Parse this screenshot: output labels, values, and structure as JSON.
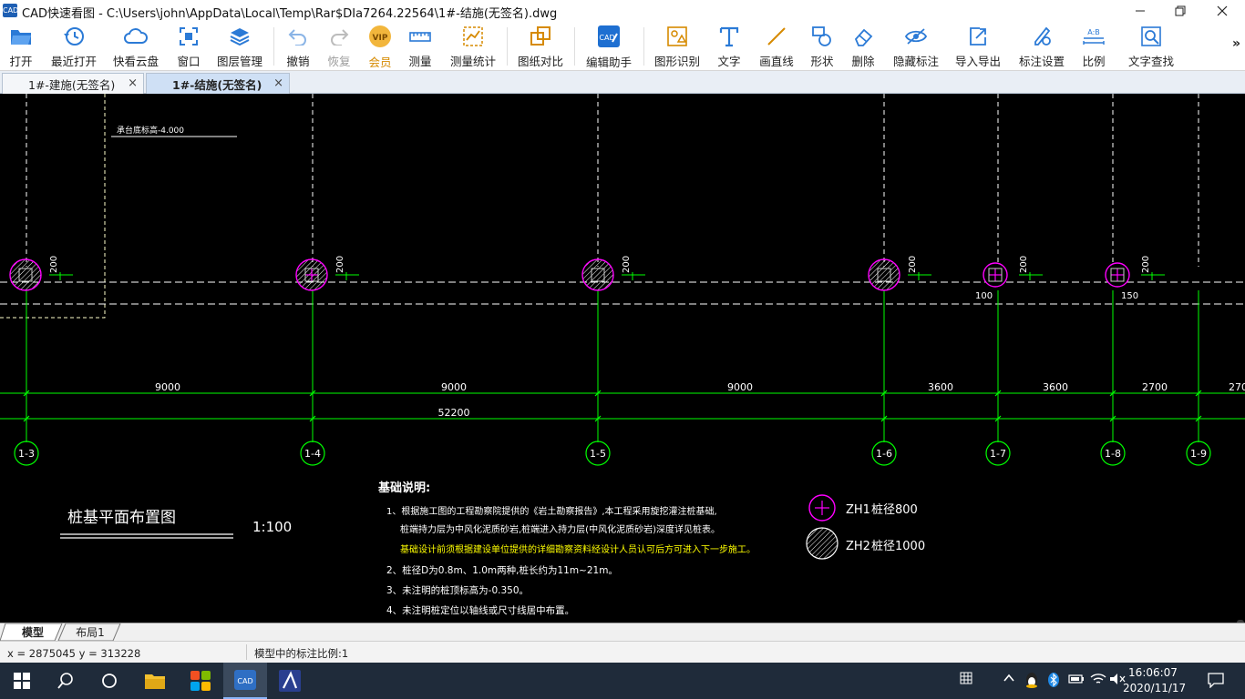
{
  "window": {
    "app_icon": "CAD",
    "title": "CAD快速看图 - C:\\Users\\john\\AppData\\Local\\Temp\\Rar$DIa7264.22564\\1#-结施(无签名).dwg"
  },
  "toolbar": {
    "open": "打开",
    "recent": "最近打开",
    "cloud": "快看云盘",
    "window": "窗口",
    "layers": "图层管理",
    "undo": "撤销",
    "redo": "恢复",
    "vip": "会员",
    "measure": "测量",
    "measure_stats": "测量统计",
    "compare": "图纸对比",
    "edit_assist": "编辑助手",
    "shape_recog": "图形识别",
    "text": "文字",
    "line": "画直线",
    "shape": "形状",
    "delete": "删除",
    "hide_dims": "隐藏标注",
    "import_export": "导入导出",
    "dim_settings": "标注设置",
    "ratio": "比例",
    "text_search": "文字查找",
    "more": "»"
  },
  "tabs": [
    {
      "label": "1#-建施(无签名)",
      "close": "×"
    },
    {
      "label": "1#-结施(无签名)",
      "close": "×"
    }
  ],
  "drawing": {
    "top_note": "承台底标高-4.000",
    "axes": [
      "1-3",
      "1-4",
      "1-5",
      "1-6",
      "1-7",
      "1-8",
      "1-9"
    ],
    "pile_dims": [
      "200",
      "200",
      "200",
      "200",
      "200",
      "200"
    ],
    "offset_labels": [
      "100",
      "150"
    ],
    "spans": [
      "9000",
      "9000",
      "9000",
      "3600",
      "3600",
      "2700",
      "270"
    ],
    "total_span": "52200",
    "plan_title": "桩基平面布置图",
    "plan_scale": "1:100",
    "notes_title": "基础说明:",
    "notes": [
      "1、根据施工图的工程勘察院提供的《岩土勘察报告》,本工程采用旋挖灌注桩基础,",
      "桩端持力层为中风化泥质砂岩,桩端进入持力层(中风化泥质砂岩)深度详见桩表。",
      "基础设计前须根据建设单位提供的详细勘察资料经设计人员认可后方可进入下一步施工。",
      "2、桩径D为0.8m、1.0m两种,桩长约为11m~21m。",
      "3、未注明的桩顶标高为-0.350。",
      "4、未注明桩定位以轴线或尺寸线居中布置。"
    ],
    "legend": [
      {
        "code": "ZH1",
        "desc": "桩径800"
      },
      {
        "code": "ZH2",
        "desc": "桩径1000"
      }
    ],
    "colors": {
      "axis": "#00ff00",
      "grid": "#ffffff",
      "pile": "#ff00ff",
      "note_highlight": "#ffff00"
    }
  },
  "layout_tabs": [
    "模型",
    "布局1"
  ],
  "status": {
    "coords": "x = 2875045  y = 313228",
    "scale": "模型中的标注比例:1"
  },
  "taskbar": {
    "time": "16:06:07",
    "date": "2020/11/17"
  }
}
